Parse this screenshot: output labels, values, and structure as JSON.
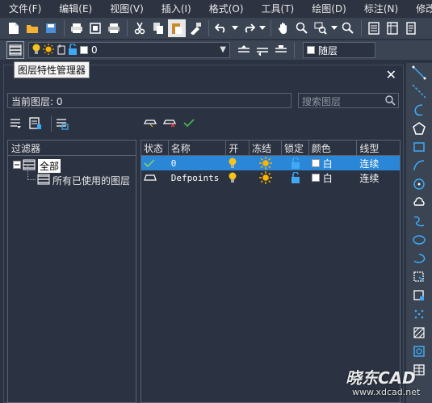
{
  "menu": [
    "文件(F)",
    "编辑(E)",
    "视图(V)",
    "插入(I)",
    "格式(O)",
    "工具(T)",
    "绘图(D)",
    "标注(N)",
    "修改(M)"
  ],
  "layer_toolbar": {
    "current_layer": "0",
    "linetype_value": "随层"
  },
  "tooltip": "图层特性管理器",
  "palette": {
    "current_layer_label": "当前图层: 0",
    "search_placeholder": "搜索图层",
    "filter_header": "过滤器",
    "filter_all": "全部",
    "filter_used": "所有已使用的图层"
  },
  "table": {
    "headers": [
      "状态",
      "名称",
      "开",
      "冻结",
      "锁定",
      "颜色",
      "线型"
    ],
    "rows": [
      {
        "name": "0",
        "color": "白",
        "linetype": "连续",
        "selected": true
      },
      {
        "name": "Defpoints",
        "color": "白",
        "linetype": "连续",
        "selected": false
      }
    ]
  },
  "watermark": {
    "brand": "晓东CAD",
    "url": "www.xdcad.net"
  },
  "colors": {
    "accent": "#2a86d6",
    "bulb": "#f5c518",
    "sun": "#ffb400",
    "lock": "#3fa9f5",
    "icon": "#3fa9f5"
  }
}
